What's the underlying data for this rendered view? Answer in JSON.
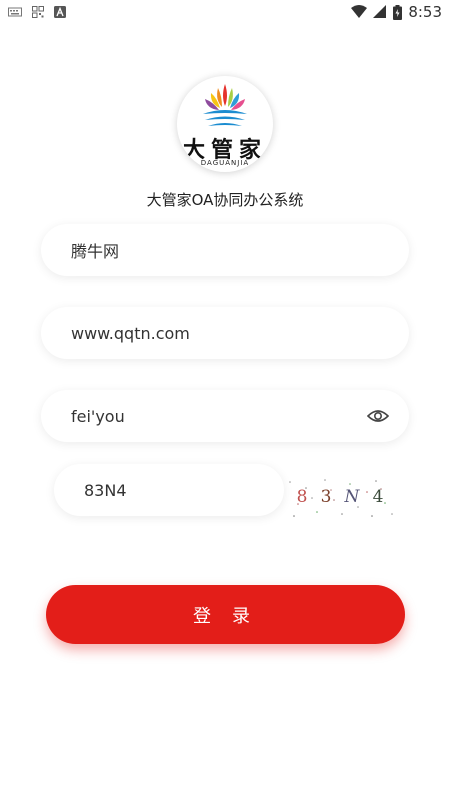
{
  "status_bar": {
    "time": "8:53"
  },
  "logo": {
    "brand_text": "大管家",
    "brand_sub": "DAGUANJIA"
  },
  "app_title": "大管家OA协同办公系统",
  "form": {
    "company_value": "腾牛网",
    "server_value": "www.qqtn.com",
    "password_value": "fei'you",
    "captcha_input_value": "83N4",
    "captcha_chars": [
      "8",
      "3",
      "N",
      "4"
    ],
    "captcha_colors": [
      "#c0504d",
      "#7b3f2a",
      "#555577",
      "#3a4a3a"
    ]
  },
  "login_button_label": "登 录",
  "colors": {
    "accent": "#e31e19"
  }
}
